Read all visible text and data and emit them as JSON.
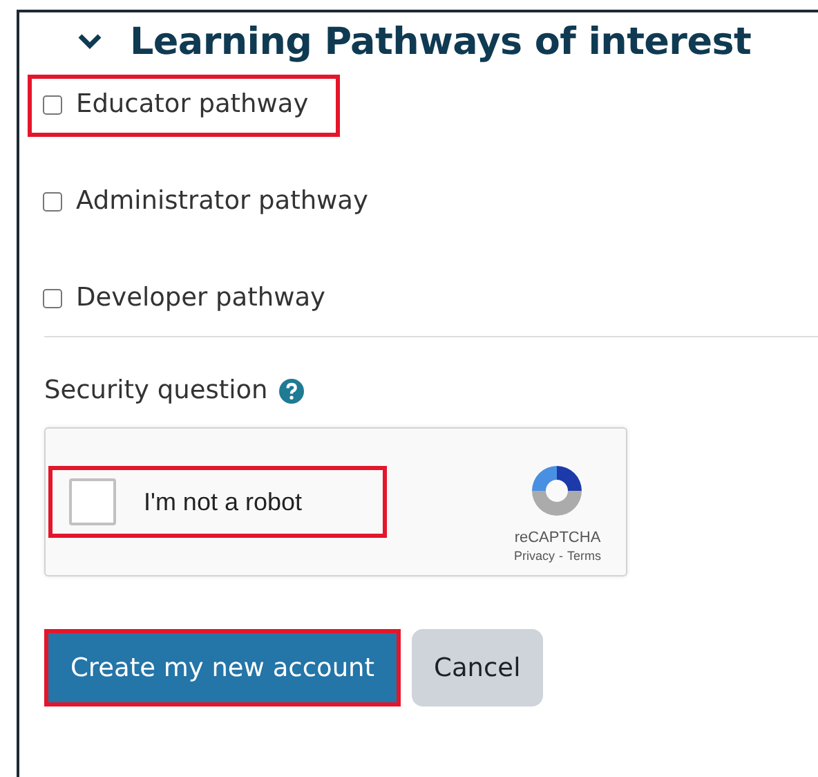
{
  "section": {
    "title": "Learning Pathways of interest",
    "expanded": true
  },
  "pathways": [
    {
      "label": "Educator pathway",
      "checked": false,
      "highlighted": true
    },
    {
      "label": "Administrator pathway",
      "checked": false,
      "highlighted": false
    },
    {
      "label": "Developer pathway",
      "checked": false,
      "highlighted": false
    }
  ],
  "security": {
    "label": "Security question",
    "captcha": {
      "label": "I'm not a robot",
      "checked": false,
      "highlighted": true,
      "brand": "reCAPTCHA",
      "links": [
        "Privacy",
        "Terms"
      ],
      "separator": "-"
    }
  },
  "buttons": [
    {
      "label": "Create my new account",
      "kind": "primary",
      "highlighted": true
    },
    {
      "label": "Cancel",
      "kind": "secondary",
      "highlighted": false
    }
  ]
}
